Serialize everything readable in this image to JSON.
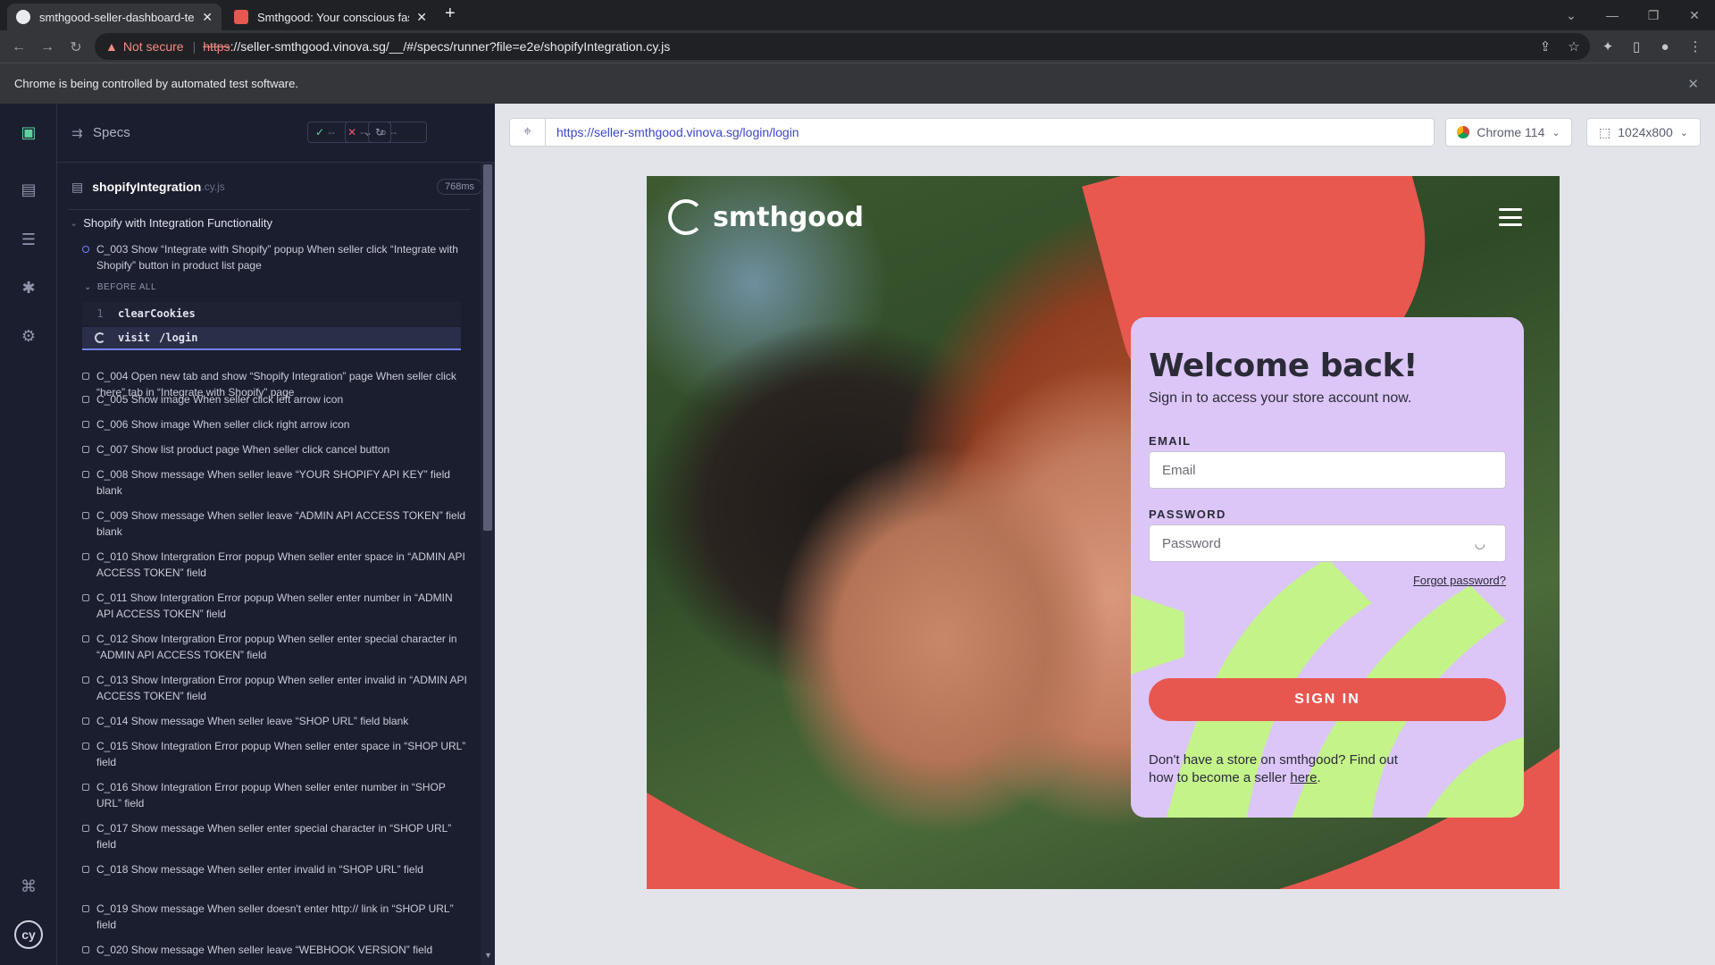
{
  "browser": {
    "tabs": [
      {
        "title": "smthgood-seller-dashboard-test",
        "active": true
      },
      {
        "title": "Smthgood: Your conscious fashio",
        "active": false
      }
    ],
    "security_label": "Not secure",
    "url_scheme": "https",
    "url_rest": "://seller-smthgood.vinova.sg/__/#/specs/runner?file=e2e/shopifyIntegration.cy.js",
    "infobar": "Chrome is being controlled by automated test software."
  },
  "specs": {
    "title": "Specs",
    "pass_label": "--",
    "fail_label": "--",
    "pending_label": "--",
    "file_name": "shopifyIntegration",
    "file_ext": ".cy.js",
    "duration": "768ms",
    "suite": "Shopify with Integration Functionality",
    "current_test": "C_003 Show “Integrate with Shopify” popup When seller click “Integrate with Shopify” button in product list page",
    "hook_label": "BEFORE ALL",
    "commands": [
      {
        "num": "1",
        "name": "clearCookies",
        "arg": ""
      },
      {
        "num": "",
        "name": "visit",
        "arg": "/login"
      }
    ],
    "tests": [
      "C_004 Open new tab and show “Shopify Integration” page When seller click “here” tab in “Integrate with Shopify” page",
      "C_005 Show image When seller click left arrow icon",
      "C_006 Show image When seller click right arrow icon",
      "C_007 Show list product page When seller click cancel button",
      "C_008 Show message When seller leave “YOUR SHOPIFY API KEY” field blank",
      "C_009 Show message When seller leave “ADMIN API ACCESS TOKEN” field blank",
      "C_010 Show Intergration Error popup When seller enter space in “ADMIN API ACCESS TOKEN” field",
      "C_011 Show Intergration Error popup When seller enter number in “ADMIN API ACCESS TOKEN” field",
      "C_012 Show Intergration Error popup When seller enter special character in “ADMIN API ACCESS TOKEN” field",
      "C_013 Show Intergration Error popup When seller enter invalid in “ADMIN API ACCESS TOKEN” field",
      "C_014 Show message When seller leave “SHOP URL” field blank",
      "C_015 Show Integration Error popup When seller enter space in “SHOP URL” field",
      "C_016 Show Integration Error popup When seller enter number in “SHOP URL” field",
      "C_017 Show message When seller enter special character in “SHOP URL” field",
      "C_018 Show message When seller enter invalid in “SHOP URL” field",
      "C_019 Show message When seller doesn't enter http:// link in “SHOP URL” field",
      "C_020 Show message When seller leave “WEBHOOK VERSION” field"
    ]
  },
  "aut": {
    "url": "https://seller-smthgood.vinova.sg/login/login",
    "browser_label": "Chrome 114",
    "viewport_label": "1024x800"
  },
  "login": {
    "brand": "smthgood",
    "heading": "Welcome back!",
    "subheading": "Sign in to access your store account now.",
    "email_label": "EMAIL",
    "email_placeholder": "Email",
    "password_label": "PASSWORD",
    "password_placeholder": "Password",
    "forgot": "Forgot password?",
    "signin": "SIGN IN",
    "footer_text": "Don't have a store on smthgood? Find out how to become a seller ",
    "footer_link": "here",
    "footer_end": "."
  },
  "colors": {
    "accent_red": "#e8574f",
    "card_lilac": "#dcc6f7",
    "card_green": "#c4f38a",
    "url_blue": "#3d46c8"
  }
}
